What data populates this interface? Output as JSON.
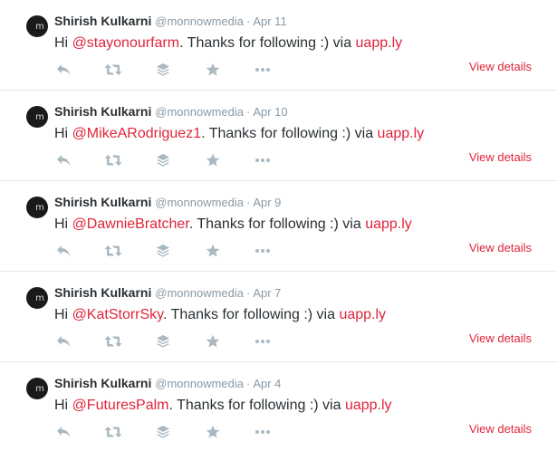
{
  "tweets": [
    {
      "name": "Shirish Kulkarni",
      "handle": "@monnowmedia",
      "separator": "·",
      "time": "Apr 11",
      "prefix": "Hi ",
      "mention": "@stayonourfarm",
      "middle": ". Thanks for following :) via ",
      "via_link": "uapp.ly",
      "view_details": "View details"
    },
    {
      "name": "Shirish Kulkarni",
      "handle": "@monnowmedia",
      "separator": "·",
      "time": "Apr 10",
      "prefix": "Hi ",
      "mention": "@MikeARodriguez1",
      "middle": ". Thanks for following :) via ",
      "via_link": "uapp.ly",
      "view_details": "View details"
    },
    {
      "name": "Shirish Kulkarni",
      "handle": "@monnowmedia",
      "separator": "·",
      "time": "Apr 9",
      "prefix": "Hi ",
      "mention": "@DawnieBratcher",
      "middle": ". Thanks for following :) via ",
      "via_link": "uapp.ly",
      "view_details": "View details"
    },
    {
      "name": "Shirish Kulkarni",
      "handle": "@monnowmedia",
      "separator": "·",
      "time": "Apr 7",
      "prefix": "Hi ",
      "mention": "@KatStorrSky",
      "middle": ". Thanks for following :) via ",
      "via_link": "uapp.ly",
      "view_details": "View details"
    },
    {
      "name": "Shirish Kulkarni",
      "handle": "@monnowmedia",
      "separator": "·",
      "time": "Apr 4",
      "prefix": "Hi ",
      "mention": "@FuturesPalm",
      "middle": ". Thanks for following :) via ",
      "via_link": "uapp.ly",
      "view_details": "View details"
    }
  ],
  "avatar_glyph": "m",
  "icons": [
    "reply-icon",
    "retweet-icon",
    "stack-icon",
    "favorite-star-icon",
    "more-icon"
  ],
  "colors": {
    "link": "#e0243a",
    "meta": "#8899a6",
    "icon": "#aab8c2",
    "divider": "#e1e8ed"
  }
}
